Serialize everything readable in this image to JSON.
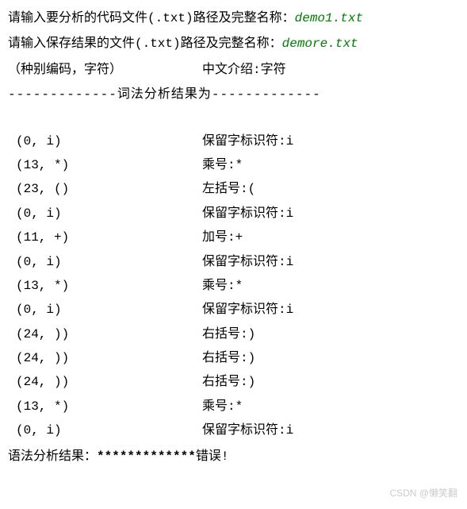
{
  "prompts": {
    "line1_label": "请输入要分析的代码文件(.txt)路径及完整名称：",
    "line1_value": "demo1.txt",
    "line2_label": "请输入保存结果的文件(.txt)路径及完整名称：",
    "line2_value": "demore.txt"
  },
  "header": {
    "left": "（种别编码，字符）",
    "right": "中文介绍:字符"
  },
  "divider": {
    "dashes_left": "-------------",
    "label": "词法分析结果为",
    "dashes_right": "-------------"
  },
  "tokens": [
    {
      "pair": "(0, i)",
      "desc": "保留字标识符:i"
    },
    {
      "pair": "(13, *)",
      "desc": "乘号:*"
    },
    {
      "pair": "(23, ()",
      "desc": "左括号:("
    },
    {
      "pair": "(0, i)",
      "desc": "保留字标识符:i"
    },
    {
      "pair": "(11, +)",
      "desc": "加号:+"
    },
    {
      "pair": "(0, i)",
      "desc": "保留字标识符:i"
    },
    {
      "pair": "(13, *)",
      "desc": "乘号:*"
    },
    {
      "pair": "(0, i)",
      "desc": "保留字标识符:i"
    },
    {
      "pair": "(24, ))",
      "desc": "右括号:)"
    },
    {
      "pair": "(24, ))",
      "desc": "右括号:)"
    },
    {
      "pair": "(24, ))",
      "desc": "右括号:)"
    },
    {
      "pair": "(13, *)",
      "desc": "乘号:*"
    },
    {
      "pair": "(0, i)",
      "desc": "保留字标识符:i"
    }
  ],
  "result": {
    "label": "语法分析结果：",
    "stars": "*************",
    "text": "错误!"
  },
  "watermark": "CSDN @懒笑翻"
}
